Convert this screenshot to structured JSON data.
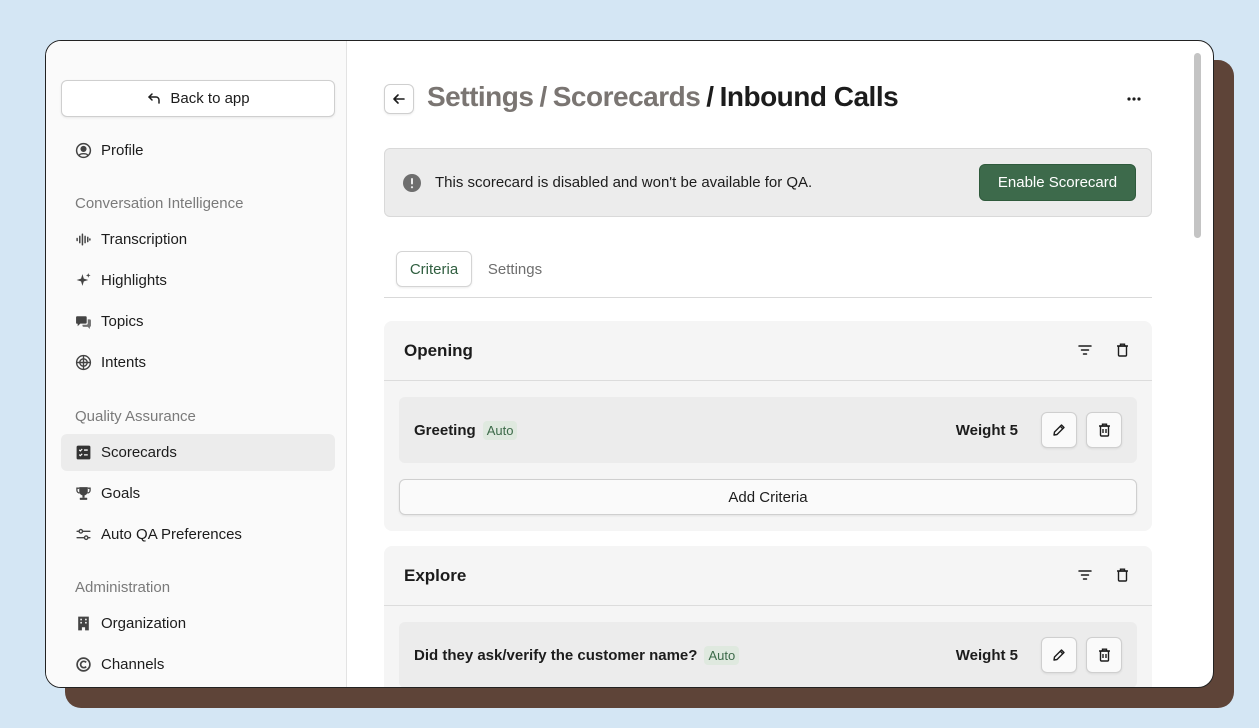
{
  "sidebar": {
    "back_label": "Back to app",
    "profile": "Profile",
    "sections": [
      {
        "label": "Conversation Intelligence",
        "items": [
          "Transcription",
          "Highlights",
          "Topics",
          "Intents"
        ]
      },
      {
        "label": "Quality Assurance",
        "items": [
          "Scorecards",
          "Goals",
          "Auto QA Preferences"
        ]
      },
      {
        "label": "Administration",
        "items": [
          "Organization",
          "Channels"
        ]
      }
    ],
    "active_item": "Scorecards"
  },
  "header": {
    "crumbs": [
      "Settings",
      "/",
      "Scorecards",
      "/"
    ],
    "current": "Inbound Calls"
  },
  "banner": {
    "text": "This scorecard is disabled and won't be available for QA.",
    "button_label": "Enable Scorecard"
  },
  "tabs": [
    {
      "label": "Criteria",
      "active": true
    },
    {
      "label": "Settings",
      "active": false
    }
  ],
  "sections": [
    {
      "title": "Opening",
      "criteria": [
        {
          "label": "Greeting",
          "badge": "Auto",
          "weight": "Weight 5"
        }
      ],
      "add_label": "Add Criteria"
    },
    {
      "title": "Explore",
      "criteria": [
        {
          "label": "Did they ask/verify the customer name?",
          "badge": "Auto",
          "weight": "Weight 5"
        }
      ]
    }
  ],
  "colors": {
    "accent_green": "#3d6a4b",
    "background": "#d4e6f4",
    "shadow": "#5e4438"
  }
}
